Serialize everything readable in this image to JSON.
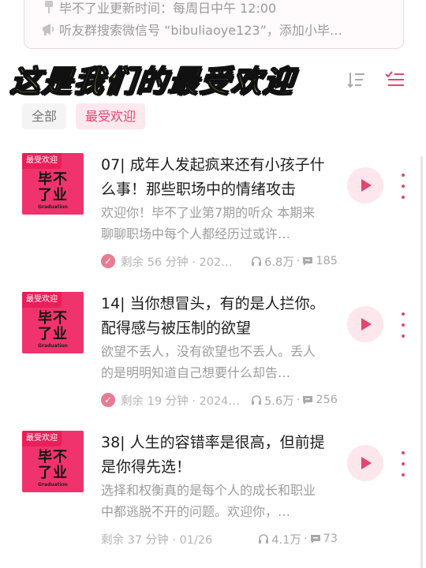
{
  "notice": {
    "line1": "毕不了业更新时间：每周日中午 12:00",
    "line2": "听友群搜索微信号 “bibuliaoye123”，添加小毕…",
    "icon1": "pushpin-icon",
    "icon2": "megaphone-icon"
  },
  "header": {
    "title": "这是我们的最受欢迎",
    "sort_icon": "sort-icon",
    "filter_icon": "filter-list-icon"
  },
  "tabs": [
    {
      "label": "全部",
      "active": false
    },
    {
      "label": "最受欢迎",
      "active": true
    }
  ],
  "cover": {
    "badge": "最受欢迎",
    "mark": "毕不\n了业",
    "sub": "Graduation",
    "color": "#f0336d"
  },
  "episodes": [
    {
      "title": "07| 成年人发起疯来还有小孩子什么事！那些职场中的情绪攻击",
      "desc": "欢迎你！毕不了业第7期的听众 本期来聊聊职场中每个人都经历过或许…",
      "meta_left": "剩余 56 分钟 · 202…",
      "plays": "6.8万",
      "comments": "185",
      "played": true
    },
    {
      "title": "14| 当你想冒头，有的是人拦你。配得感与被压制的欲望",
      "desc": "欲望不丢人，没有欲望也不丢人。丢人的是明明知道自己想要什么却告…",
      "meta_left": "剩余 19 分钟 · 2024…",
      "plays": "5.6万",
      "comments": "256",
      "played": true
    },
    {
      "title": "38| 人生的容错率是很高，但前提是你得先选！",
      "desc": "选择和权衡真的是每个人的成长和职业中都逃脱不开的问题。欢迎你，…",
      "meta_left": "剩余 37 分钟 · 01/26",
      "plays": "4.1万",
      "comments": "73",
      "played": false
    }
  ],
  "colors": {
    "accent": "#e2456e",
    "title_fill": "#d6f53a",
    "cover": "#f0336d"
  }
}
